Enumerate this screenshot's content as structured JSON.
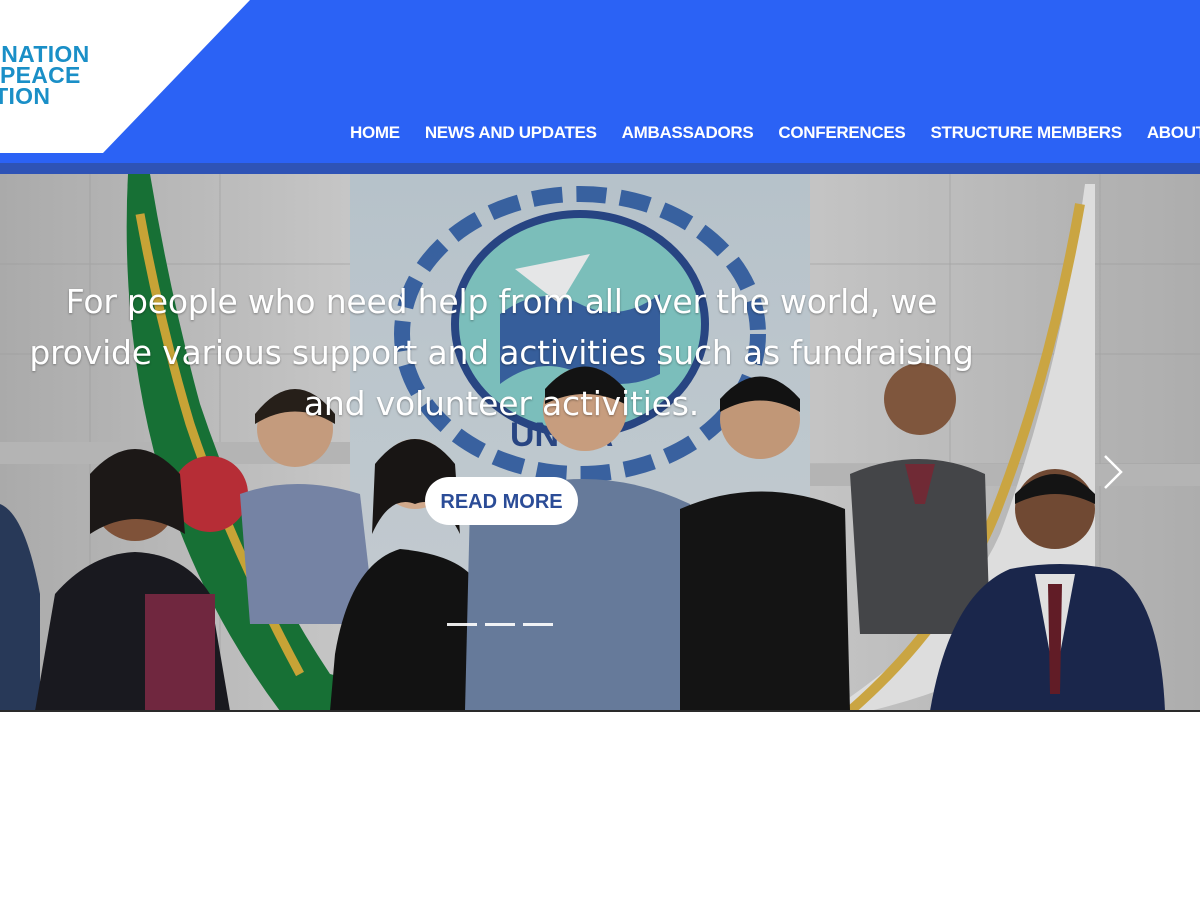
{
  "logo": {
    "lines": [
      "ED NATION",
      "LD PEACE",
      "CATION"
    ]
  },
  "nav": {
    "items": [
      "HOME",
      "NEWS AND UPDATES",
      "AMBASSADORS",
      "CONFERENCES",
      "STRUCTURE MEMBERS",
      "ABOUT US"
    ]
  },
  "hero": {
    "caption_lines": [
      "For people who need help from all over the world, we",
      "provide various support and activities such as fundraising",
      "and volunteer activities."
    ],
    "button_label": "READ MORE",
    "slide_count": 3,
    "photo_sign_text": "UN  PA"
  },
  "colors": {
    "header_blue": "#2b62f5",
    "header_stripe": "#2e53b6",
    "logo_text": "#1a8fc7",
    "button_text": "#2b4c97"
  },
  "icons": {
    "next": "chevron-right-icon",
    "photo": "group-photo-image"
  }
}
